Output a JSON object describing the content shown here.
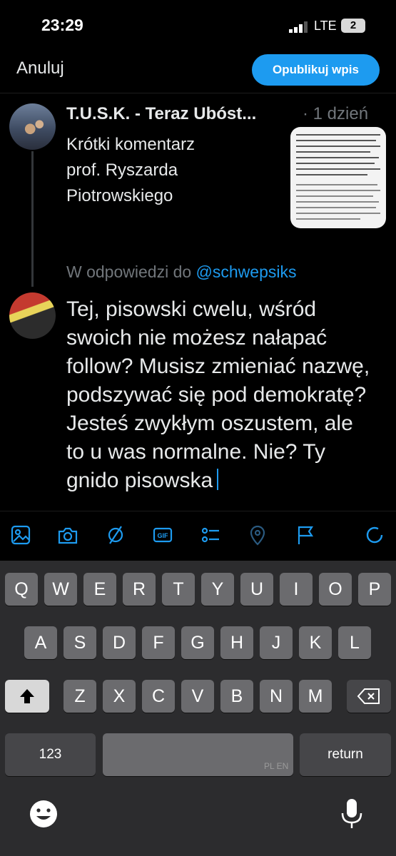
{
  "status_bar": {
    "time": "23:29",
    "network": "LTE",
    "battery": "2"
  },
  "header": {
    "cancel_label": "Anuluj",
    "publish_label": "Opublikuj wpis"
  },
  "tweet": {
    "author": "T.U.S.K. - Teraz Ubóst...",
    "time_ago": "· 1 dzień",
    "text": "Krótki komentarz\nprof. Ryszarda\nPiotrowskiego"
  },
  "reply": {
    "prefix": "W odpowiedzi do ",
    "handle": "@schwepsiks"
  },
  "compose": {
    "text": "Tej, pisowski cwelu, wśród swoich nie możesz nałapać follow? Musisz zmieniać nazwę, podszywać się pod demokratę? Jesteś zwykłym oszustem, ale to u was normalne. Nie? Ty gnido pisowska"
  },
  "toolbar": {
    "icons": [
      "image-icon",
      "camera-icon",
      "gif-icon-alt",
      "gif-icon",
      "poll-icon",
      "location-icon",
      "flag-icon",
      "progress-circle-icon"
    ],
    "accent": "#1d9bf0"
  },
  "keyboard": {
    "row1": [
      "Q",
      "W",
      "E",
      "R",
      "T",
      "Y",
      "U",
      "I",
      "O",
      "P"
    ],
    "row2": [
      "A",
      "S",
      "D",
      "F",
      "G",
      "H",
      "J",
      "K",
      "L"
    ],
    "row3": [
      "Z",
      "X",
      "C",
      "V",
      "B",
      "N",
      "M"
    ],
    "numbers_label": "123",
    "return_label": "return",
    "language_label": "PL EN"
  }
}
